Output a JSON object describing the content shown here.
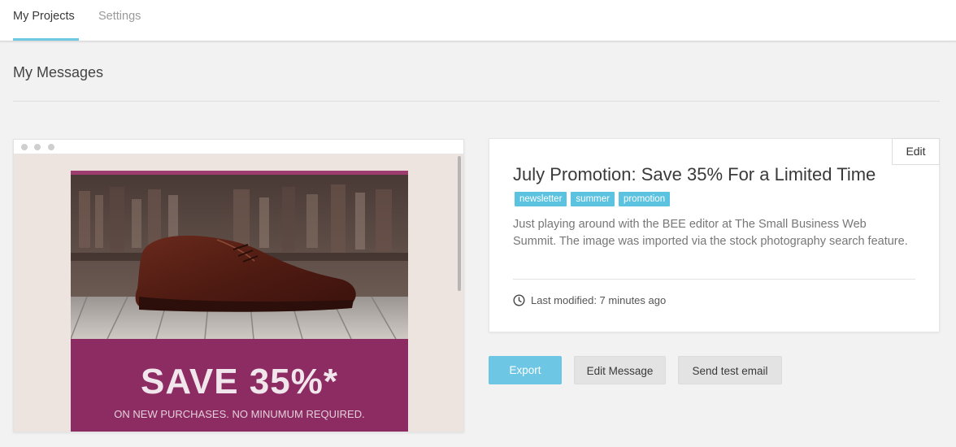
{
  "nav": {
    "tabs": [
      {
        "label": "My Projects",
        "active": true
      },
      {
        "label": "Settings",
        "active": false
      }
    ]
  },
  "page": {
    "title": "My Messages"
  },
  "preview": {
    "headline": "SAVE 35%*",
    "subline": "ON NEW PURCHASES. NO MINUMUM REQUIRED."
  },
  "card": {
    "edit_label": "Edit",
    "title": "July Promotion: Save 35% For a Limited Time",
    "tags": [
      "newsletter",
      "summer",
      "promotion"
    ],
    "description": "Just playing around with the BEE editor at The Small Business Web Summit. The image was imported via the stock photography search feature.",
    "modified": "Last modified: 7 minutes ago"
  },
  "actions": {
    "export": "Export",
    "edit_message": "Edit Message",
    "send_test": "Send test email"
  },
  "colors": {
    "accent": "#6cc6e4",
    "tag": "#5bc3e0",
    "email_bg": "#8d2b63"
  }
}
